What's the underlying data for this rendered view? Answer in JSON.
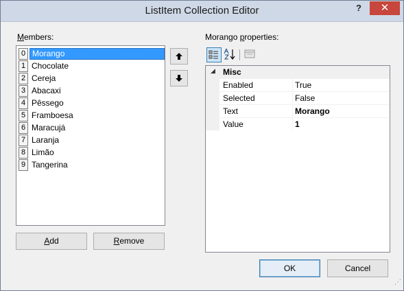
{
  "window": {
    "title": "ListItem Collection Editor",
    "help_glyph": "?",
    "close_glyph": "✕"
  },
  "members": {
    "label_key": "M",
    "label_rest": "embers:",
    "items": [
      {
        "index": "0",
        "name": "Morango"
      },
      {
        "index": "1",
        "name": "Chocolate"
      },
      {
        "index": "2",
        "name": "Cereja"
      },
      {
        "index": "3",
        "name": "Abacaxi"
      },
      {
        "index": "4",
        "name": "Pêssego"
      },
      {
        "index": "5",
        "name": "Framboesa"
      },
      {
        "index": "6",
        "name": "Maracujá"
      },
      {
        "index": "7",
        "name": "Laranja"
      },
      {
        "index": "8",
        "name": "Limão"
      },
      {
        "index": "9",
        "name": "Tangerina"
      }
    ],
    "selected_index": 0,
    "move_up_glyph": "🡅",
    "move_down_glyph": "🡇"
  },
  "buttons": {
    "add_key": "A",
    "add_rest": "dd",
    "remove_key": "R",
    "remove_rest": "emove",
    "ok": "OK",
    "cancel": "Cancel"
  },
  "properties": {
    "label_pre": "Morango ",
    "label_key": "p",
    "label_post": "roperties:",
    "toolbar": {
      "categorized_icon": "categorized-icon",
      "alphabetical_icon": "alphabetical-icon",
      "property_pages_icon": "property-pages-icon"
    },
    "category": "Misc",
    "rows": [
      {
        "name": "Enabled",
        "value": "True",
        "bold": false
      },
      {
        "name": "Selected",
        "value": "False",
        "bold": false
      },
      {
        "name": "Text",
        "value": "Morango",
        "bold": true
      },
      {
        "name": "Value",
        "value": "1",
        "bold": true
      }
    ]
  },
  "colors": {
    "selection": "#3399ff",
    "close_button": "#c7463d",
    "titlebar": "#cfd8e6"
  }
}
